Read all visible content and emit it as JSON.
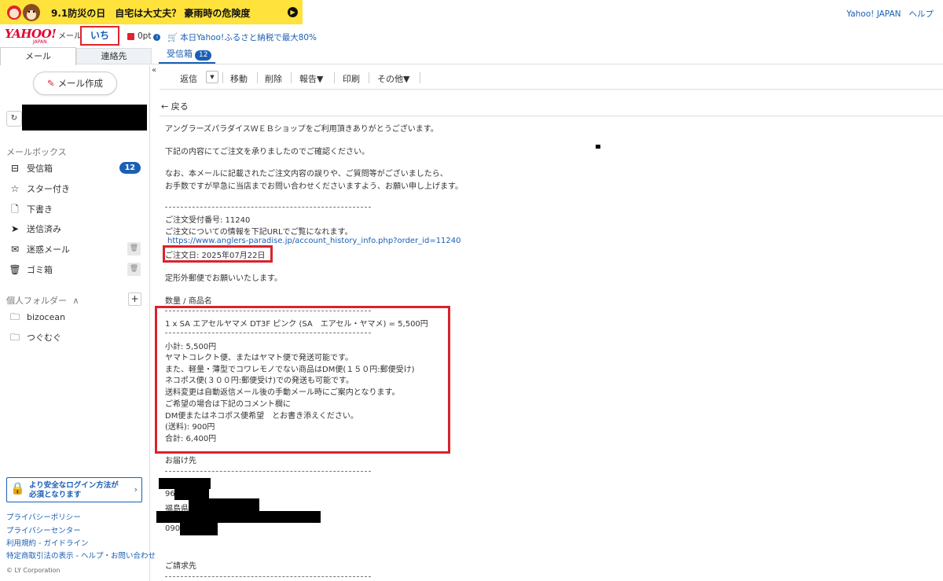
{
  "banner": {
    "text": "9.1防災の日　自宅は大丈夫？ 豪雨時の危険度",
    "go_icon": "chevron-right-icon"
  },
  "top_links": [
    "Yahoo! JAPAN",
    "ヘルプ"
  ],
  "header": {
    "logo": "YAHOO!",
    "logo_sub": "JAPAN",
    "logo_service": "メール",
    "user_name": "いち",
    "points": "0pt",
    "promo": "本日Yahoo!ふるさと納税で最大80%"
  },
  "tabs": {
    "mail": "メール",
    "contacts": "連絡先",
    "inbox": "受信箱",
    "inbox_count": "12"
  },
  "sidebar": {
    "compose": "メール作成",
    "mailbox_heading": "メールボックス",
    "folders": [
      {
        "label": "受信箱",
        "icon": "inbox-icon",
        "count": "12"
      },
      {
        "label": "スター付き",
        "icon": "star-icon"
      },
      {
        "label": "下書き",
        "icon": "draft-icon"
      },
      {
        "label": "送信済み",
        "icon": "sent-icon"
      },
      {
        "label": "迷惑メール",
        "icon": "spam-icon"
      },
      {
        "label": "ゴミ箱",
        "icon": "trash-icon"
      }
    ],
    "personal_heading": "個人フォルダー",
    "personal_folders": [
      {
        "label": "bizocean",
        "icon": "folder-icon"
      },
      {
        "label": "つぐむぐ",
        "icon": "folder-icon"
      }
    ],
    "secure_login_line1": "より安全なログイン方法が",
    "secure_login_line2": "必須となります",
    "footer_links": [
      "プライバシーポリシー",
      "プライバシーセンター",
      "利用規約 - ガイドライン",
      "特定商取引法の表示 - ヘルプ・お問い合わせ"
    ],
    "copyright": "© LY Corporation"
  },
  "toolbar": {
    "reply": "返信",
    "move": "移動",
    "delete": "削除",
    "report": "報告▼",
    "print": "印刷",
    "more": "その他▼"
  },
  "back": "戻る",
  "email": {
    "greeting": "アングラーズパラダイスＷＥＢショップをご利用頂きありがとうございます。",
    "confirm": "下記の内容にてご注文を承りましたのでご確認ください。",
    "note1": "なお、本メールに記載されたご注文内容の誤りや、ご質問等がございましたら、",
    "note2": "お手数ですが早急に当店までお問い合わせくださいますよう、お願い申し上げます。",
    "order_number": "ご注文受付番号: 11240",
    "order_info": "ご注文についての情報を下記URLでご覧になれます。",
    "order_url": "https://www.anglers-paradise.jp/account_history_info.php?order_id=11240",
    "order_date": "ご注文日: 2025年07月22日",
    "shipping_method": "定形外郵便でお願いいたします。",
    "items_heading": "数量 / 商品名",
    "item_line": "1 x SA エアセルヤマメ DT3F ピンク (SA　エアセル・ヤマメ) = 5,500円",
    "subtotal": "小計: 5,500円",
    "ship1": "ヤマトコレクト便、またはヤマト便で発送可能です。",
    "ship2": "また、軽量・薄型でコワレモノでない商品はDM便(１５０円:郵便受け)",
    "ship3": "ネコポス便(３００円:郵便受け)での発送も可能です。",
    "ship4": "送料変更は自動返信メール後の手動メール時にご案内となります。",
    "ship5": "ご希望の場合は下記のコメント欄に",
    "ship6": "DM便またはネコポス便希望　とお書き添えください。",
    "postage": " (送料): 900円",
    "total": "合計: 6,400円",
    "delivery_heading": "お届け先",
    "addr_postal_prefix": "96",
    "addr_prefecture": "福島県",
    "addr_phone_prefix": "090",
    "billing_heading": "ご請求先"
  }
}
